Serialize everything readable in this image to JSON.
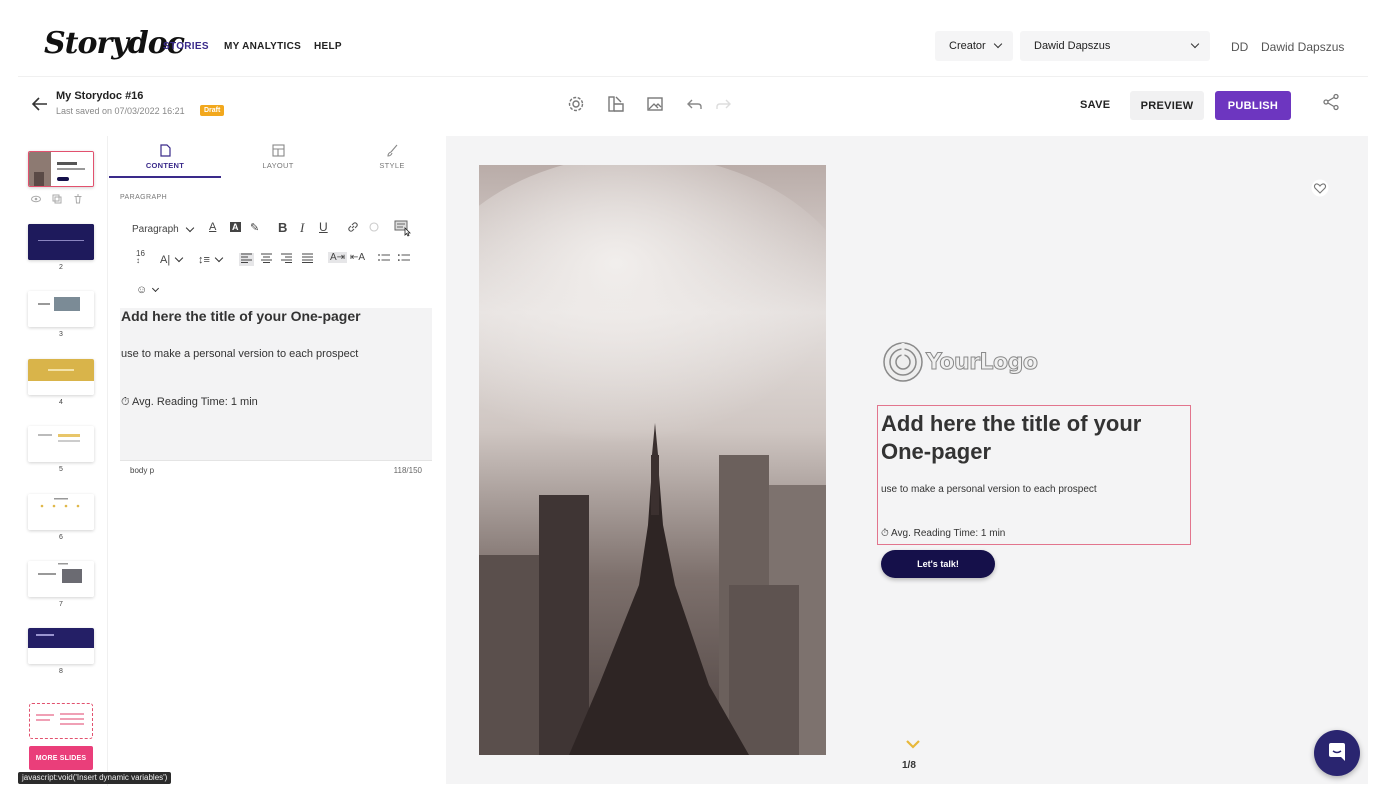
{
  "nav": {
    "brand": "Storydoc",
    "links": [
      "STORIES",
      "MY ANALYTICS",
      "HELP"
    ],
    "role_select": "Creator",
    "account_select": "Dawid Dapszus",
    "initials": "DD",
    "user_name": "Dawid Dapszus"
  },
  "editbar": {
    "doc_title": "My Storydoc #16",
    "saved_text": "Last saved on 07/03/2022 16:21",
    "badge": "Draft",
    "save_label": "SAVE",
    "preview_label": "PREVIEW",
    "publish_label": "PUBLISH",
    "icons": [
      "gear-icon",
      "layout-icon",
      "image-icon",
      "undo-icon",
      "redo-icon",
      "share-icon"
    ]
  },
  "slides": {
    "numbers": [
      "2",
      "3",
      "4",
      "5",
      "6",
      "7",
      "8"
    ],
    "more_label": "MORE SLIDES"
  },
  "panel": {
    "tabs": [
      "CONTENT",
      "LAYOUT",
      "STYLE"
    ],
    "section": "PARAGRAPH",
    "block_format": "Paragraph",
    "content_title": "Add here the title of your One-pager",
    "content_para": "use to make a personal version to each prospect",
    "content_read": "Avg. Reading Time: 1 min",
    "status_path": "body   p",
    "char_count": "118/150"
  },
  "slide": {
    "logo_text": "YourLogo",
    "title": "Add here the title of your One-pager",
    "subtitle": "use  to make a personal version to each prospect",
    "reading": "Avg. Reading Time: 1 min",
    "cta": "Let's talk!",
    "pager": "1/8"
  },
  "statusbar": "javascript:void('Insert dynamic variables')",
  "colors": {
    "accent": "#6d36c0",
    "nav_active": "#3a2a8a",
    "draft": "#f2a81d",
    "more_slides": "#ea3e7a",
    "cta": "#15104a",
    "highlight_border": "#e2758d"
  }
}
